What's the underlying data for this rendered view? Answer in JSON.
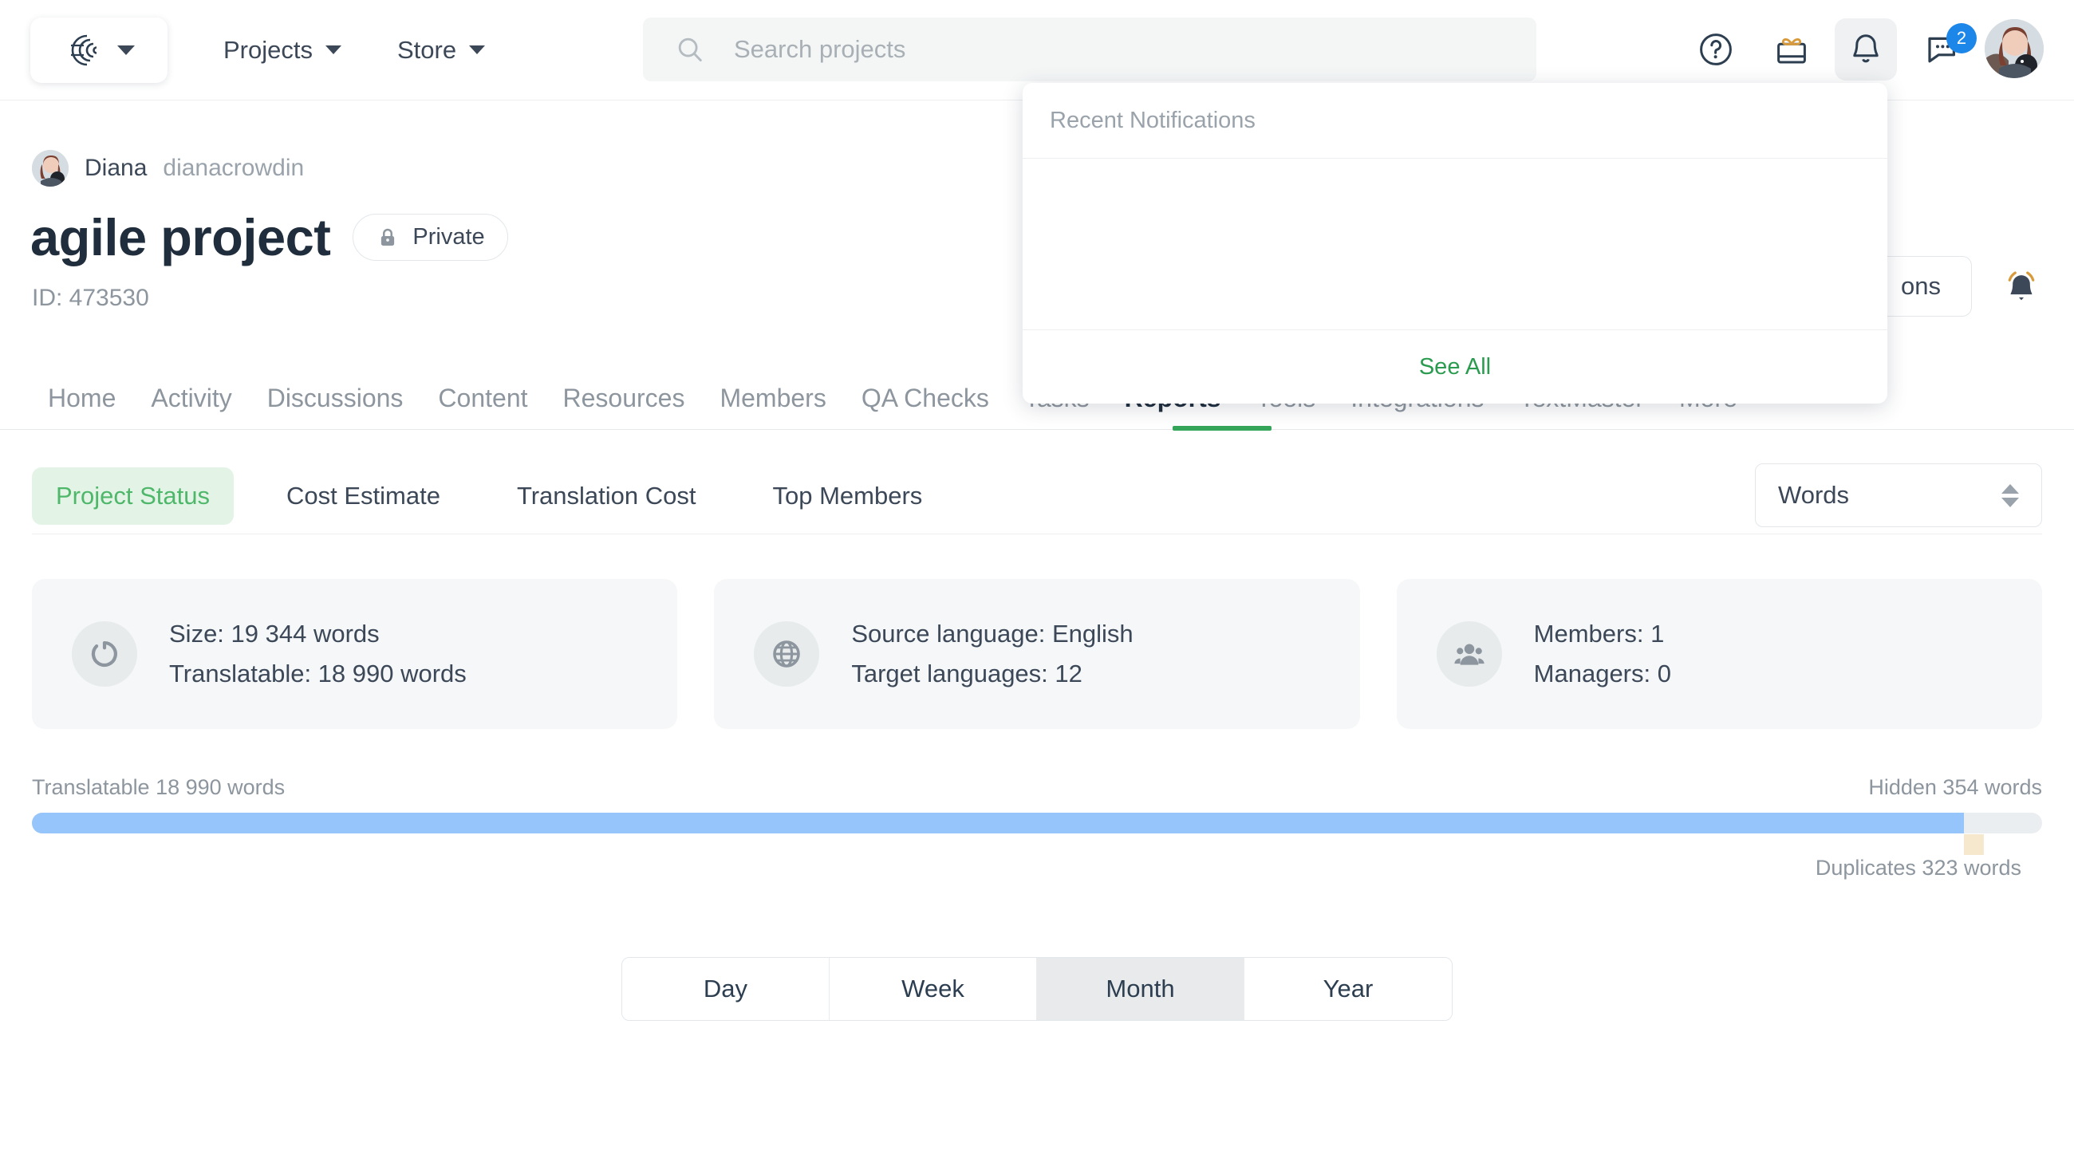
{
  "topbar": {
    "logo_icon": "crowdin-logo-icon",
    "logo_caret": "chevron-down-icon",
    "nav": [
      {
        "label": "Projects",
        "icon": "chevron-down-icon"
      },
      {
        "label": "Store",
        "icon": "chevron-down-icon"
      }
    ],
    "search": {
      "placeholder": "Search projects",
      "value": "",
      "icon": "search-icon"
    },
    "icons": [
      {
        "name": "help-icon",
        "glyph": "?"
      },
      {
        "name": "gift-icon",
        "glyph": "gift"
      },
      {
        "name": "bell-icon",
        "glyph": "bell"
      },
      {
        "name": "messages-icon",
        "glyph": "chat",
        "badge": "2"
      }
    ],
    "avatar_alt": "user-avatar"
  },
  "notifications": {
    "title": "Recent Notifications",
    "see_all": "See All",
    "items": []
  },
  "project": {
    "owner_name": "Diana",
    "owner_handle": "dianacrowdin",
    "title": "agile project",
    "visibility": "Private",
    "visibility_icon": "lock-icon",
    "id_label": "ID: 473530",
    "actions_button": "ons",
    "subscribe_icon": "bell-ring-icon"
  },
  "tabs": [
    {
      "label": "Home",
      "active": false
    },
    {
      "label": "Activity",
      "active": false
    },
    {
      "label": "Discussions",
      "active": false
    },
    {
      "label": "Content",
      "active": false
    },
    {
      "label": "Resources",
      "active": false
    },
    {
      "label": "Members",
      "active": false
    },
    {
      "label": "QA Checks",
      "active": false
    },
    {
      "label": "Tasks",
      "active": false
    },
    {
      "label": "Reports",
      "active": true
    },
    {
      "label": "Tools",
      "active": false
    },
    {
      "label": "Integrations",
      "active": false
    },
    {
      "label": "TextMaster",
      "active": false
    },
    {
      "label": "More",
      "active": false,
      "icon": "chevron-down-icon"
    }
  ],
  "subtabs": [
    {
      "label": "Project Status",
      "active": true
    },
    {
      "label": "Cost Estimate",
      "active": false
    },
    {
      "label": "Translation Cost",
      "active": false
    },
    {
      "label": "Top Members",
      "active": false
    }
  ],
  "unit_select": {
    "value": "Words",
    "icon": "updown-arrows-icon"
  },
  "cards": [
    {
      "icon": "size-ring-icon",
      "line1": "Size: 19 344 words",
      "line2": "Translatable: 18 990 words"
    },
    {
      "icon": "globe-icon",
      "line1": "Source language: English",
      "line2": "Target languages: 12"
    },
    {
      "icon": "members-icon",
      "line1": "Members: 1",
      "line2": "Managers: 0"
    }
  ],
  "progress": {
    "left_label": "Translatable 18 990 words",
    "right_label": "Hidden 354 words",
    "sub_label": "Duplicates 323 words",
    "fill_percent": 96.1,
    "dup_left_percent": 96.1,
    "dup_width_percent": 1.0,
    "fill_color": "#96c5fb",
    "track_color": "#ebeef0",
    "dup_color": "#f6e8cd"
  },
  "period": [
    {
      "label": "Day",
      "active": false
    },
    {
      "label": "Week",
      "active": false
    },
    {
      "label": "Month",
      "active": true
    },
    {
      "label": "Year",
      "active": false
    }
  ],
  "colors": {
    "accent_green": "#35a559",
    "active_subtab_bg": "#e3f4e7",
    "badge_blue": "#1c87e8"
  }
}
